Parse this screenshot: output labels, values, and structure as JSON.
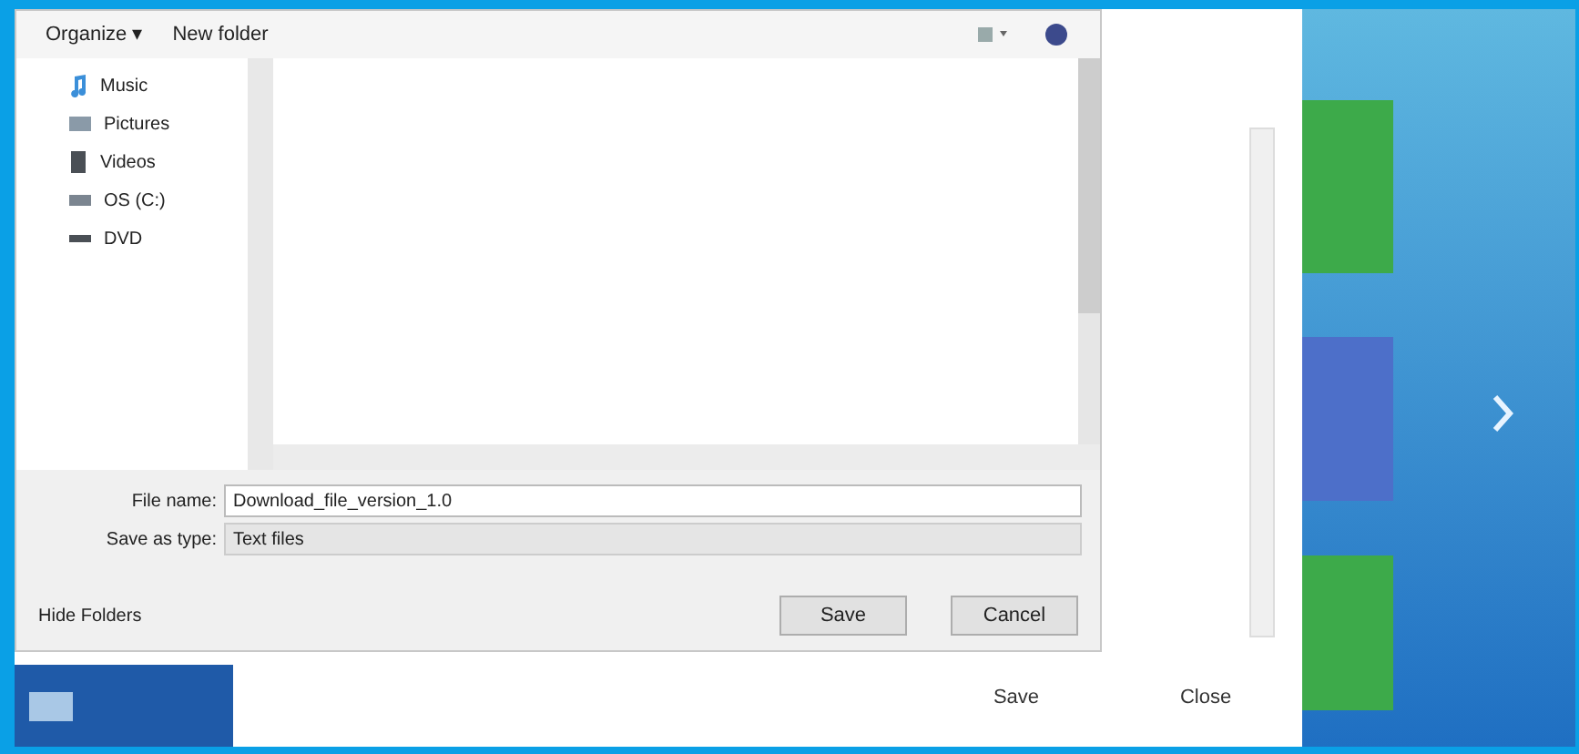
{
  "dialog": {
    "toolbar": {
      "organize": "Organize ▾",
      "new_folder": "New folder"
    },
    "nav_items": [
      {
        "label": "Music",
        "kind": "music"
      },
      {
        "label": "Pictures",
        "kind": "pictures"
      },
      {
        "label": "Videos",
        "kind": "videos"
      },
      {
        "label": "OS (C:)",
        "kind": "drive"
      },
      {
        "label": "DVD",
        "kind": "disc"
      }
    ],
    "file_name": {
      "label": "File name:",
      "value": "Download_file_version_1.0"
    },
    "save_as_type": {
      "label": "Save as type:",
      "value": "Text files"
    },
    "hide_folders": "Hide Folders",
    "buttons": [
      "Save",
      "Cancel"
    ]
  },
  "back_window": {
    "buttons": [
      "Save",
      "Close"
    ]
  }
}
